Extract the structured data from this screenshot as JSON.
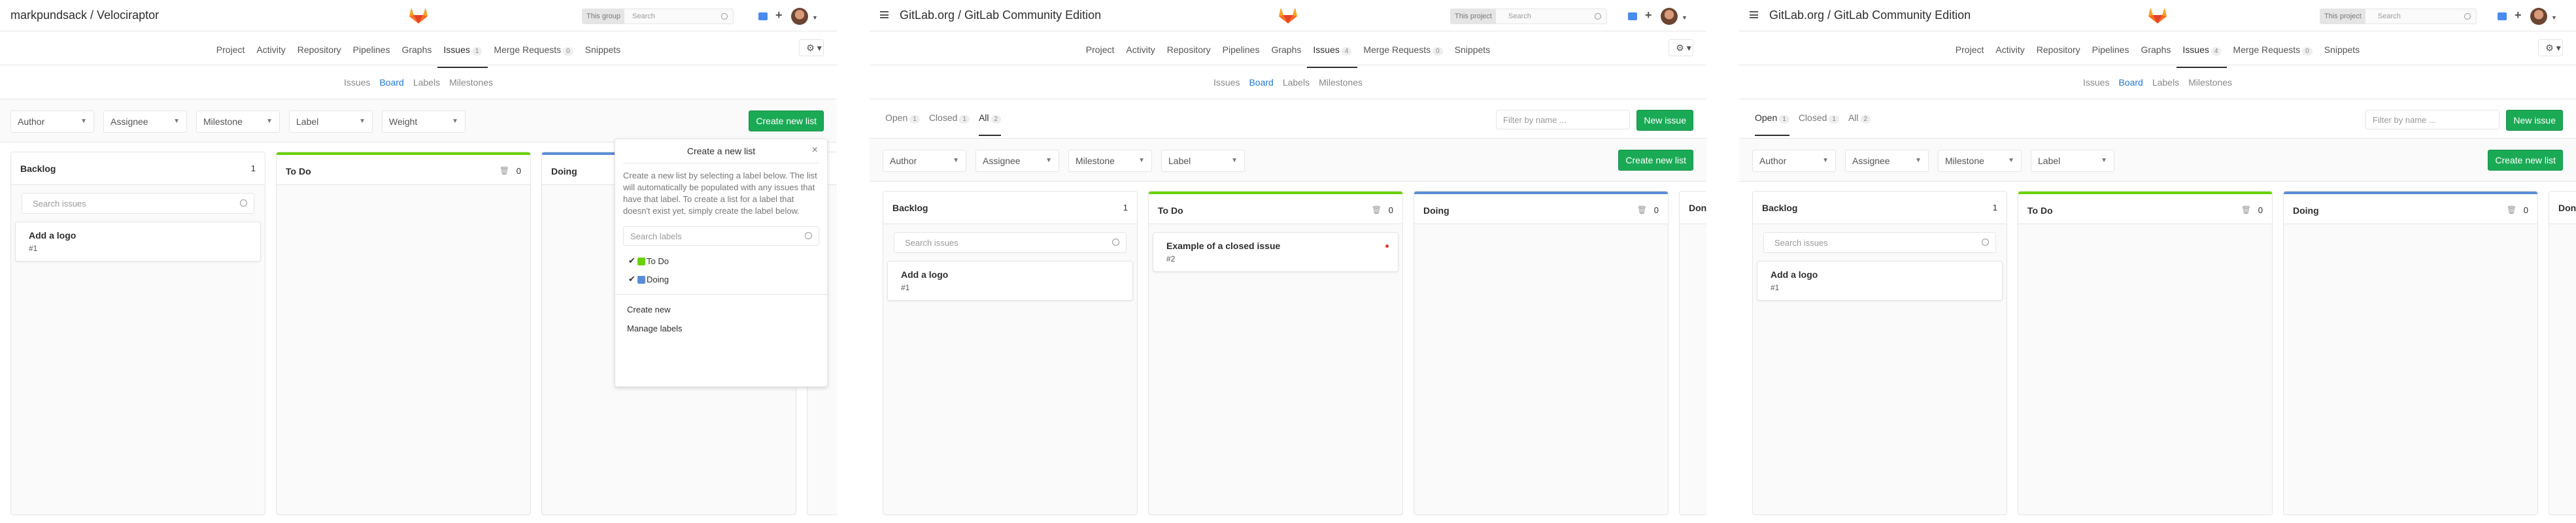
{
  "panel1": {
    "title": "markpundsack / Velociraptor",
    "search_scope": "This group",
    "search_placeholder": "Search",
    "nav": [
      {
        "label": "Project"
      },
      {
        "label": "Activity"
      },
      {
        "label": "Repository"
      },
      {
        "label": "Pipelines"
      },
      {
        "label": "Graphs"
      },
      {
        "label": "Issues",
        "badge": "1",
        "active": true
      },
      {
        "label": "Merge Requests",
        "badge": "0"
      },
      {
        "label": "Snippets"
      }
    ],
    "subnav": [
      "Issues",
      "Board",
      "Labels",
      "Milestones"
    ],
    "filters": [
      "Author",
      "Assignee",
      "Milestone",
      "Label",
      "Weight"
    ],
    "create_list": "Create new list",
    "lists": [
      {
        "title": "Backlog",
        "count": "1",
        "search_placeholder": "Search issues",
        "cards": [
          {
            "title": "Add a logo",
            "num": "#1"
          }
        ]
      },
      {
        "title": "To Do",
        "count": "0"
      },
      {
        "title": "Doing",
        "count": ""
      },
      {
        "title": "on",
        "count": ""
      }
    ],
    "popup": {
      "title": "Create a new list",
      "close": "×",
      "description": "Create a new list by selecting a label below. The list will automatically be populated with any issues that have that label. To create a list for a label that doesn't exist yet, simply create the label below.",
      "search_placeholder": "Search labels",
      "labels": [
        {
          "name": "To Do",
          "color": "#69d100"
        },
        {
          "name": "Doing",
          "color": "#5b8dd6"
        }
      ],
      "create_new": "Create new",
      "manage_labels": "Manage labels"
    }
  },
  "panel2": {
    "title": "GitLab.org / GitLab Community Edition",
    "search_scope": "This project",
    "search_placeholder": "Search",
    "nav": [
      {
        "label": "Project"
      },
      {
        "label": "Activity"
      },
      {
        "label": "Repository"
      },
      {
        "label": "Pipelines"
      },
      {
        "label": "Graphs"
      },
      {
        "label": "Issues",
        "badge": "4",
        "active": true
      },
      {
        "label": "Merge Requests",
        "badge": "0"
      },
      {
        "label": "Snippets"
      }
    ],
    "subnav": [
      "Issues",
      "Board",
      "Labels",
      "Milestones"
    ],
    "state_tabs": [
      {
        "label": "Open",
        "badge": "1"
      },
      {
        "label": "Closed",
        "badge": "1"
      },
      {
        "label": "All",
        "badge": "2",
        "active": true
      }
    ],
    "filter_placeholder": "Filter by name ...",
    "new_issue": "New issue",
    "filters": [
      "Author",
      "Assignee",
      "Milestone",
      "Label"
    ],
    "create_list": "Create new list",
    "lists": [
      {
        "title": "Backlog",
        "count": "1",
        "search_placeholder": "Search issues",
        "cards": [
          {
            "title": "Add a logo",
            "num": "#1"
          }
        ]
      },
      {
        "title": "To Do",
        "count": "0",
        "cards": [
          {
            "title": "Example of a closed issue",
            "num": "#2"
          }
        ]
      },
      {
        "title": "Doing",
        "count": "0"
      },
      {
        "title": "Don",
        "count": ""
      }
    ]
  },
  "panel3": {
    "title": "GitLab.org / GitLab Community Edition",
    "search_scope": "This project",
    "search_placeholder": "Search",
    "nav": [
      {
        "label": "Project"
      },
      {
        "label": "Activity"
      },
      {
        "label": "Repository"
      },
      {
        "label": "Pipelines"
      },
      {
        "label": "Graphs"
      },
      {
        "label": "Issues",
        "badge": "4",
        "active": true
      },
      {
        "label": "Merge Requests",
        "badge": "0"
      },
      {
        "label": "Snippets"
      }
    ],
    "subnav": [
      "Issues",
      "Board",
      "Labels",
      "Milestones"
    ],
    "state_tabs": [
      {
        "label": "Open",
        "badge": "1",
        "active": true
      },
      {
        "label": "Closed",
        "badge": "1"
      },
      {
        "label": "All",
        "badge": "2"
      }
    ],
    "filter_placeholder": "Filter by name ...",
    "new_issue": "New issue",
    "filters": [
      "Author",
      "Assignee",
      "Milestone",
      "Label"
    ],
    "create_list": "Create new list",
    "lists": [
      {
        "title": "Backlog",
        "count": "1",
        "search_placeholder": "Search issues",
        "cards": [
          {
            "title": "Add a logo",
            "num": "#1"
          }
        ]
      },
      {
        "title": "To Do",
        "count": "0"
      },
      {
        "title": "Doing",
        "count": "0"
      },
      {
        "title": "Don",
        "count": ""
      }
    ]
  }
}
